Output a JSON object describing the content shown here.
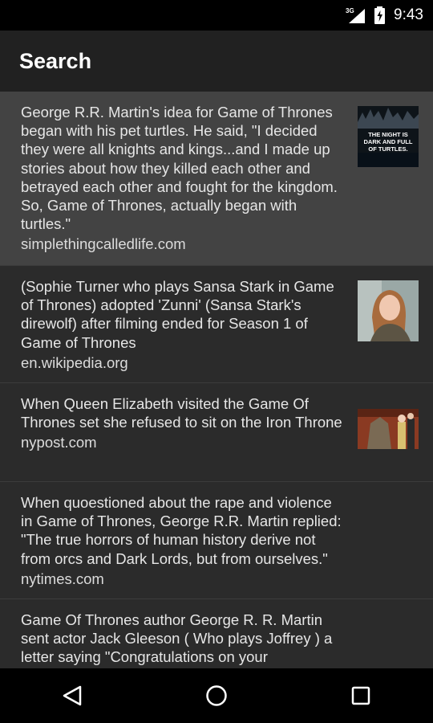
{
  "status": {
    "time": "9:43",
    "network": "3G"
  },
  "appbar": {
    "title": "Search"
  },
  "results": [
    {
      "text": "George R.R. Martin's idea for Game of Thrones began with his pet turtles. He said, \"I decided they were all knights and kings...and I made up stories about how they killed each other and betrayed each other and fought for the kingdom. So, Game of Thrones, actually began with turtles.\"",
      "source": "simplethingcalledlife.com",
      "thumb_caption": [
        "THE NIGHT IS",
        "DARK AND FULL",
        "OF TURTLES."
      ]
    },
    {
      "text": "(Sophie Turner who plays Sansa Stark in Game of Thrones) adopted 'Zunni' (Sansa Stark's direwolf) after filming ended for Season 1 of Game of Thrones",
      "source": "en.wikipedia.org"
    },
    {
      "text": "When Queen Elizabeth visited the Game Of Thrones set she refused to sit on the Iron Throne",
      "source": "nypost.com"
    },
    {
      "text": "When quoestioned about the rape and violence in Game of Thrones, George R.R. Martin replied: \"The true horrors of human history derive not from orcs and Dark Lords, but from ourselves.\"",
      "source": "nytimes.com"
    },
    {
      "text": "Game Of Thrones author George R. R. Martin sent actor Jack Gleeson ( Who plays Joffrey ) a letter saying \"Congratulations on your",
      "source": ""
    }
  ]
}
